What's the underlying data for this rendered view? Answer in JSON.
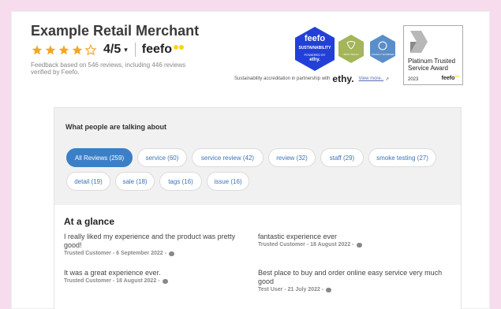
{
  "merchant": {
    "name": "Example Retail Merchant",
    "score": "4/5",
    "chevron": "▾",
    "feedback": "Feedback based on 546 reviews, including 446 reviews verified by Feefo.",
    "stars": 4
  },
  "badges": {
    "feefo_logo": "feefo",
    "sustainability_title": "feefo",
    "sustainability_label": "SUSTAINABILITY",
    "powered_by": "POWERED BY",
    "powered_brand": "ethy.",
    "green_label": "BEST VEGAN",
    "blue_label": "LOCALLY SOURCED",
    "accreditation_text": "Sustainability accreditation in partnership with",
    "ethy_logo": "ethy.",
    "view_more": "View more..",
    "award_title": "Platinum Trusted Service Award",
    "award_year": "2023",
    "award_feefo": "feefo"
  },
  "talk": {
    "heading": "What people are talking about",
    "chips": [
      {
        "label": "All Reviews (259)",
        "active": true
      },
      {
        "label": "service (60)"
      },
      {
        "label": "service review (42)"
      },
      {
        "label": "review (32)"
      },
      {
        "label": "staff (29)"
      },
      {
        "label": "smoke testing (27)"
      },
      {
        "label": "detail (19)"
      },
      {
        "label": "sale (18)"
      },
      {
        "label": "tags (16)"
      },
      {
        "label": "issue (16)"
      }
    ]
  },
  "glance": {
    "title": "At a glance",
    "reviews": [
      {
        "text": "I really liked my experience and the product was pretty good!",
        "meta": "Trusted Customer - 6 September 2022 -"
      },
      {
        "text": "fantastic experience ever",
        "meta": "Trusted Customer - 18 August 2022 -"
      },
      {
        "text": "It was a great experience ever.",
        "meta": "Trusted Customer - 18 August 2022 -"
      },
      {
        "text": "Best place to buy and order online easy service very much good",
        "meta": "Test User - 21 July 2022 -"
      }
    ]
  },
  "colors": {
    "star": "#f5a623",
    "chip_active": "#3b80c6",
    "feefo_badge": "#2240d8",
    "green_hex": "#a4b55a",
    "blue_hex": "#5b8ec9"
  }
}
